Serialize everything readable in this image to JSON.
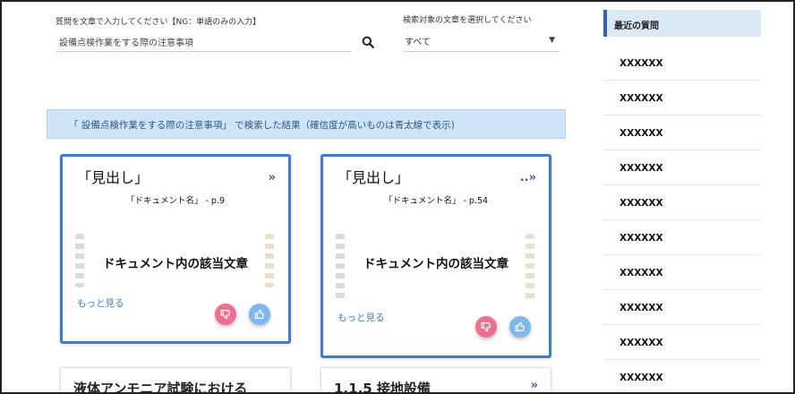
{
  "search": {
    "question_label": "質問を文章で入力してください【NG：単語のみの入力】",
    "question_value": "設備点検作業をする際の注意事項",
    "target_label": "検索対象の文章を選択してください",
    "target_value": "すべて"
  },
  "banner": {
    "text": "「 設備点検作業をする際の注意事項」 で検索した結果（確信度が高いものは青太線で表示)"
  },
  "cards": [
    {
      "title": "「見出し」",
      "doc": "「ドキュメント名」 - p.9",
      "body": "ドキュメント内の該当文章",
      "more": "もっと見る"
    },
    {
      "title": "「見出し」",
      "doc": "「ドキュメント名」 - p.54",
      "body": "ドキュメント内の該当文章",
      "more": "もっと見る"
    }
  ],
  "partial_cards": [
    {
      "title": "液体アンモニア試験における"
    },
    {
      "title": "1.1.5 接地設備"
    }
  ],
  "sidebar": {
    "title": "最近の質問",
    "items": [
      "XXXXXX",
      "XXXXXX",
      "XXXXXX",
      "XXXXXX",
      "XXXXXX",
      "XXXXXX",
      "XXXXXX",
      "XXXXXX",
      "XXXXXX",
      "XXXXXX"
    ]
  },
  "icons": {
    "search": "search-icon",
    "dropdown": "caret-down-icon",
    "open": "chevron-double-right-icon",
    "thumbs_down": "thumbs-down-icon",
    "thumbs_up": "thumbs-up-icon"
  },
  "colors": {
    "accent": "#3e7bd8",
    "banner_bg": "#cfe4f7",
    "thumbs_down": "#ee6f8e",
    "thumbs_up": "#7fb8ee",
    "sidebar_head": "#dbe9f6"
  }
}
